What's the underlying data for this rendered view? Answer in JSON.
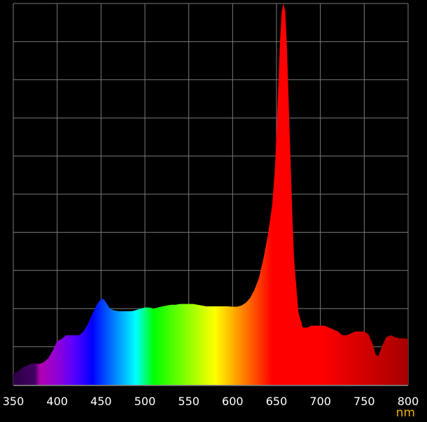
{
  "chart_data": {
    "type": "area",
    "title": "",
    "xlabel": "nm",
    "ylabel": "",
    "xlim": [
      350,
      800
    ],
    "ylim": [
      0,
      1
    ],
    "x_ticks": [
      350,
      400,
      450,
      500,
      550,
      600,
      650,
      700,
      750,
      800
    ],
    "x_tick_labels": [
      "350",
      "400",
      "450",
      "500",
      "550",
      "600",
      "650",
      "700",
      "750",
      "800"
    ],
    "y_gridlines": 10,
    "grid": true,
    "legend": "none",
    "fill": "wavelength-spectrum-colors",
    "series": [
      {
        "x": [
          350,
          355,
          360,
          365,
          370,
          375,
          380,
          385,
          390,
          395,
          400,
          405,
          410,
          415,
          420,
          425,
          430,
          435,
          440,
          445,
          450,
          453,
          456,
          460,
          465,
          470,
          475,
          480,
          485,
          490,
          495,
          500,
          505,
          510,
          515,
          520,
          525,
          530,
          535,
          540,
          545,
          550,
          555,
          560,
          565,
          570,
          575,
          580,
          585,
          590,
          595,
          600,
          605,
          610,
          615,
          620,
          625,
          630,
          635,
          640,
          645,
          648,
          650,
          652,
          654,
          656,
          658,
          660,
          662,
          665,
          668,
          670,
          675,
          680,
          685,
          690,
          695,
          700,
          705,
          710,
          715,
          720,
          725,
          730,
          735,
          740,
          745,
          750,
          755,
          760,
          763,
          766,
          770,
          775,
          780,
          785,
          790,
          795,
          800
        ],
        "y": [
          0.03,
          0.035,
          0.045,
          0.05,
          0.055,
          0.057,
          0.055,
          0.06,
          0.07,
          0.09,
          0.115,
          0.12,
          0.13,
          0.13,
          0.13,
          0.13,
          0.14,
          0.16,
          0.185,
          0.21,
          0.225,
          0.225,
          0.215,
          0.2,
          0.195,
          0.193,
          0.193,
          0.193,
          0.193,
          0.196,
          0.2,
          0.203,
          0.203,
          0.2,
          0.203,
          0.206,
          0.208,
          0.21,
          0.21,
          0.212,
          0.212,
          0.212,
          0.212,
          0.21,
          0.208,
          0.206,
          0.206,
          0.206,
          0.206,
          0.206,
          0.206,
          0.205,
          0.205,
          0.208,
          0.215,
          0.228,
          0.25,
          0.28,
          0.33,
          0.39,
          0.47,
          0.56,
          0.66,
          0.78,
          0.9,
          0.98,
          1.0,
          0.98,
          0.88,
          0.66,
          0.45,
          0.33,
          0.19,
          0.15,
          0.15,
          0.155,
          0.155,
          0.155,
          0.155,
          0.15,
          0.145,
          0.14,
          0.13,
          0.13,
          0.135,
          0.14,
          0.14,
          0.14,
          0.132,
          0.105,
          0.08,
          0.075,
          0.1,
          0.125,
          0.13,
          0.125,
          0.122,
          0.122,
          0.12
        ]
      }
    ]
  }
}
